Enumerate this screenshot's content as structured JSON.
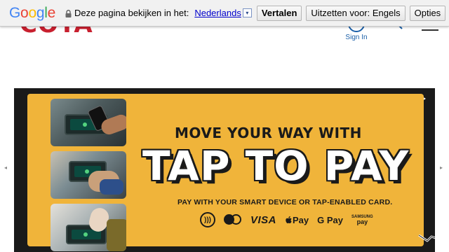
{
  "translate_bar": {
    "logo": "Google",
    "prompt": "Deze pagina bekijken in het:",
    "language": "Nederlands",
    "dropdown_glyph": "▾",
    "translate_button": "Vertalen",
    "disable_button": "Uitzetten voor: Engels",
    "options_button": "Opties",
    "lock_icon": "lock-icon"
  },
  "site_header": {
    "logo_text": "COTA",
    "sign_in_label": "Sign In",
    "colors": {
      "brand_red": "#c8202f",
      "link_blue": "#1a5fa8"
    }
  },
  "slider": {
    "prev_glyph": "◂",
    "next_glyph": "▸",
    "stop_control": "stop-icon",
    "play_control": "play-icon"
  },
  "banner": {
    "headline_small": "MOVE YOUR WAY WITH",
    "headline_big": "TAP TO PAY",
    "subline": "PAY WITH YOUR SMART DEVICE OR TAP-ENABLED CARD.",
    "contactless_glyph": ")))",
    "payment_methods": {
      "visa": "VISA",
      "apple_pay": " Pay",
      "google_pay": "G Pay",
      "samsung_top": "SAMSUNG",
      "samsung_bottom": "pay"
    },
    "colors": {
      "background": "#f0b43a",
      "ink": "#1a1a1a",
      "headline_fill": "#ffffff"
    }
  }
}
